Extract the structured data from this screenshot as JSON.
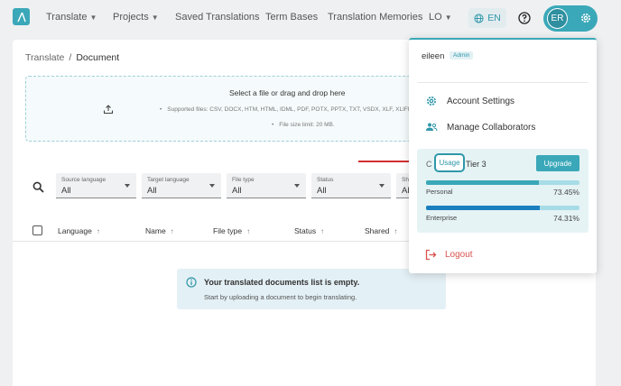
{
  "colors": {
    "accent": "#3aa8b8",
    "accent_dark": "#2f97a9",
    "enterprise_bar": "#1b7fbf",
    "logout": "#d9534f",
    "arrow": "#d32f2f"
  },
  "nav": {
    "items": [
      {
        "label": "Translate",
        "has_dropdown": true
      },
      {
        "label": "Projects",
        "has_dropdown": true
      },
      {
        "label": "Saved Translations",
        "has_dropdown": false
      },
      {
        "label": "Term Bases",
        "has_dropdown": false
      },
      {
        "label": "Translation Memories",
        "has_dropdown": false
      },
      {
        "label": "LO",
        "has_dropdown": true
      }
    ],
    "lang_label": "EN",
    "avatar_initials": "ER"
  },
  "breadcrumb": {
    "root": "Translate",
    "sep": "/",
    "current": "Document"
  },
  "upload": {
    "title": "Select a file or drag and drop here",
    "supported": "Supported files: CSV, DOCX, HTM, HTML, IDML, PDF, POTX, PPTX, TXT, VSDX, XLF, XLIFF",
    "limit": "File size limit: 20 MB."
  },
  "filters": [
    {
      "label": "Source language",
      "value": "All"
    },
    {
      "label": "Target language",
      "value": "All"
    },
    {
      "label": "File type",
      "value": "All"
    },
    {
      "label": "Status",
      "value": "All"
    },
    {
      "label": "Sh",
      "value": "Al"
    }
  ],
  "table": {
    "columns": [
      "Language",
      "Name",
      "File type",
      "Status",
      "Shared"
    ]
  },
  "empty": {
    "title": "Your translated documents list is empty.",
    "subtitle": "Start by uploading a document to begin translating."
  },
  "menu": {
    "username": "eileen",
    "role": "Admin",
    "account_settings": "Account Settings",
    "manage_collaborators": "Manage Collaborators",
    "usage_prefix": "C",
    "usage_label": "Usage",
    "tier": "Tier 3",
    "upgrade": "Upgrade",
    "personal_label": "Personal",
    "personal_pct": "73.45%",
    "personal_fraction": 0.7345,
    "enterprise_label": "Enterprise",
    "enterprise_pct": "74.31%",
    "enterprise_fraction": 0.7431,
    "logout": "Logout"
  }
}
